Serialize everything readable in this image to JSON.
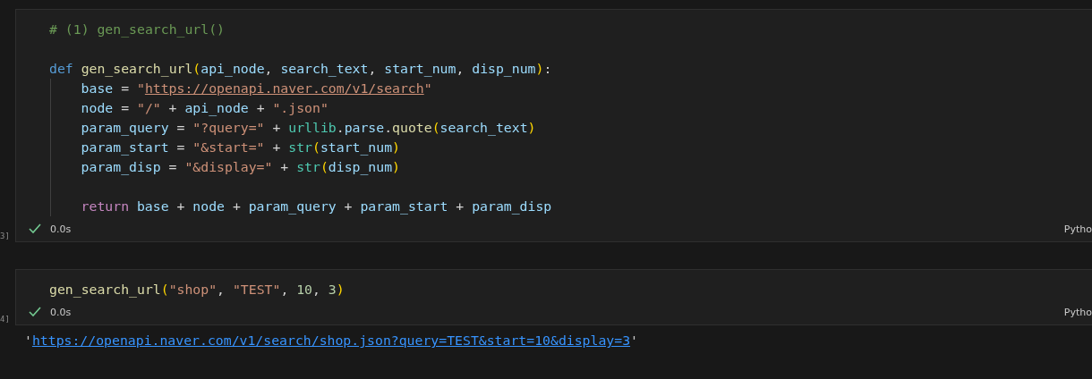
{
  "cells": [
    {
      "count": "3]",
      "lines": [
        {
          "kind": "code",
          "indented": false,
          "tokens": [
            {
              "kind": "comment",
              "text": "# (1) gen_search_url()"
            }
          ]
        },
        {
          "kind": "blank"
        },
        {
          "kind": "code",
          "indented": false,
          "tokens": [
            {
              "kind": "keyword",
              "text": "def "
            },
            {
              "kind": "function",
              "text": "gen_search_url"
            },
            {
              "kind": "bracket",
              "text": "("
            },
            {
              "kind": "variable",
              "text": "api_node"
            },
            {
              "kind": "plain",
              "text": ", "
            },
            {
              "kind": "variable",
              "text": "search_text"
            },
            {
              "kind": "plain",
              "text": ", "
            },
            {
              "kind": "variable",
              "text": "start_num"
            },
            {
              "kind": "plain",
              "text": ", "
            },
            {
              "kind": "variable",
              "text": "disp_num"
            },
            {
              "kind": "bracket",
              "text": ")"
            },
            {
              "kind": "plain",
              "text": ":"
            }
          ]
        },
        {
          "kind": "code",
          "indented": true,
          "tokens": [
            {
              "kind": "variable",
              "text": "base"
            },
            {
              "kind": "plain",
              "text": " = "
            },
            {
              "kind": "string",
              "text": "\""
            },
            {
              "kind": "link-string",
              "text": "https://openapi.naver.com/v1/search"
            },
            {
              "kind": "string",
              "text": "\""
            }
          ]
        },
        {
          "kind": "code",
          "indented": true,
          "tokens": [
            {
              "kind": "variable",
              "text": "node"
            },
            {
              "kind": "plain",
              "text": " = "
            },
            {
              "kind": "string",
              "text": "\"/\""
            },
            {
              "kind": "plain",
              "text": " + "
            },
            {
              "kind": "variable",
              "text": "api_node"
            },
            {
              "kind": "plain",
              "text": " + "
            },
            {
              "kind": "string",
              "text": "\".json\""
            }
          ]
        },
        {
          "kind": "code",
          "indented": true,
          "tokens": [
            {
              "kind": "variable",
              "text": "param_query"
            },
            {
              "kind": "plain",
              "text": " = "
            },
            {
              "kind": "string",
              "text": "\"?query=\""
            },
            {
              "kind": "plain",
              "text": " + "
            },
            {
              "kind": "builtin",
              "text": "urllib"
            },
            {
              "kind": "plain",
              "text": "."
            },
            {
              "kind": "variable",
              "text": "parse"
            },
            {
              "kind": "plain",
              "text": "."
            },
            {
              "kind": "function",
              "text": "quote"
            },
            {
              "kind": "bracket",
              "text": "("
            },
            {
              "kind": "variable",
              "text": "search_text"
            },
            {
              "kind": "bracket",
              "text": ")"
            }
          ]
        },
        {
          "kind": "code",
          "indented": true,
          "tokens": [
            {
              "kind": "variable",
              "text": "param_start"
            },
            {
              "kind": "plain",
              "text": " = "
            },
            {
              "kind": "string",
              "text": "\"&start=\""
            },
            {
              "kind": "plain",
              "text": " + "
            },
            {
              "kind": "builtin",
              "text": "str"
            },
            {
              "kind": "bracket",
              "text": "("
            },
            {
              "kind": "variable",
              "text": "start_num"
            },
            {
              "kind": "bracket",
              "text": ")"
            }
          ]
        },
        {
          "kind": "code",
          "indented": true,
          "tokens": [
            {
              "kind": "variable",
              "text": "param_disp"
            },
            {
              "kind": "plain",
              "text": " = "
            },
            {
              "kind": "string",
              "text": "\"&display=\""
            },
            {
              "kind": "plain",
              "text": " + "
            },
            {
              "kind": "builtin",
              "text": "str"
            },
            {
              "kind": "bracket",
              "text": "("
            },
            {
              "kind": "variable",
              "text": "disp_num"
            },
            {
              "kind": "bracket",
              "text": ")"
            }
          ]
        },
        {
          "kind": "blank"
        },
        {
          "kind": "code",
          "indented": true,
          "tokens": [
            {
              "kind": "control",
              "text": "return "
            },
            {
              "kind": "variable",
              "text": "base"
            },
            {
              "kind": "plain",
              "text": " + "
            },
            {
              "kind": "variable",
              "text": "node"
            },
            {
              "kind": "plain",
              "text": " + "
            },
            {
              "kind": "variable",
              "text": "param_query"
            },
            {
              "kind": "plain",
              "text": " + "
            },
            {
              "kind": "variable",
              "text": "param_start"
            },
            {
              "kind": "plain",
              "text": " + "
            },
            {
              "kind": "variable",
              "text": "param_disp"
            }
          ]
        }
      ],
      "succeeded": true,
      "time": "0.0s",
      "language": "Pytho"
    },
    {
      "count": "4]",
      "lines": [
        {
          "kind": "code",
          "indented": false,
          "tokens": [
            {
              "kind": "function",
              "text": "gen_search_url"
            },
            {
              "kind": "bracket",
              "text": "("
            },
            {
              "kind": "string",
              "text": "\"shop\""
            },
            {
              "kind": "plain",
              "text": ", "
            },
            {
              "kind": "string",
              "text": "\"TEST\""
            },
            {
              "kind": "plain",
              "text": ", "
            },
            {
              "kind": "number",
              "text": "10"
            },
            {
              "kind": "plain",
              "text": ", "
            },
            {
              "kind": "number",
              "text": "3"
            },
            {
              "kind": "bracket",
              "text": ")"
            }
          ]
        }
      ],
      "succeeded": true,
      "time": "0.0s",
      "language": "Pytho",
      "output": {
        "quote_open": "'",
        "link": "https://openapi.naver.com/v1/search/shop.json?query=TEST&start=10&display=3",
        "quote_close": "'"
      }
    }
  ]
}
